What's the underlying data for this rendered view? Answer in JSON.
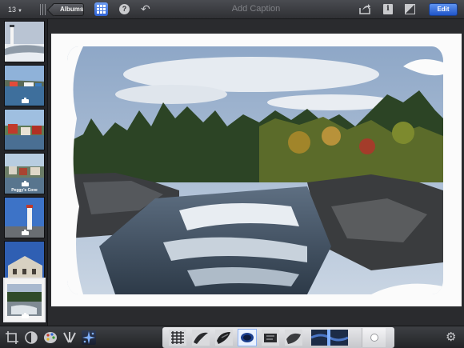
{
  "toolbar": {
    "photo_count": "13",
    "albums_label": "Albums",
    "help_label": "?",
    "caption_placeholder": "Add Caption",
    "info_label": "i",
    "edit_label": "Edit"
  },
  "thumbnails": [
    {
      "name": "lighthouse-winter",
      "label": ""
    },
    {
      "name": "harbor-boats",
      "label": "",
      "badge": true
    },
    {
      "name": "red-houses",
      "label": ""
    },
    {
      "name": "peggys-cove",
      "label": "Peggy's Cove",
      "badge": true
    },
    {
      "name": "lighthouse-blue-sky",
      "label": "",
      "badge": true
    },
    {
      "name": "victorian-building",
      "label": ""
    },
    {
      "name": "waterfall",
      "label": "",
      "badge": true,
      "selected": true
    }
  ],
  "colors": {
    "accent": "#2f63d6",
    "toolbar_dark": "#2f3034",
    "canvas_bg": "#fbfbfb"
  },
  "bottom_tools": [
    {
      "name": "crop-tool-icon"
    },
    {
      "name": "exposure-tool-icon"
    },
    {
      "name": "color-tool-icon"
    },
    {
      "name": "brushes-tool-icon"
    },
    {
      "name": "effects-tool-icon",
      "active": true
    }
  ],
  "brushes": [
    "repair-brush-icon",
    "red-eye-brush-icon",
    "saturate-brush-icon",
    "desaturate-brush-icon",
    "lighten-brush-icon",
    "darken-brush-icon",
    "sharpen-brush-icon"
  ]
}
